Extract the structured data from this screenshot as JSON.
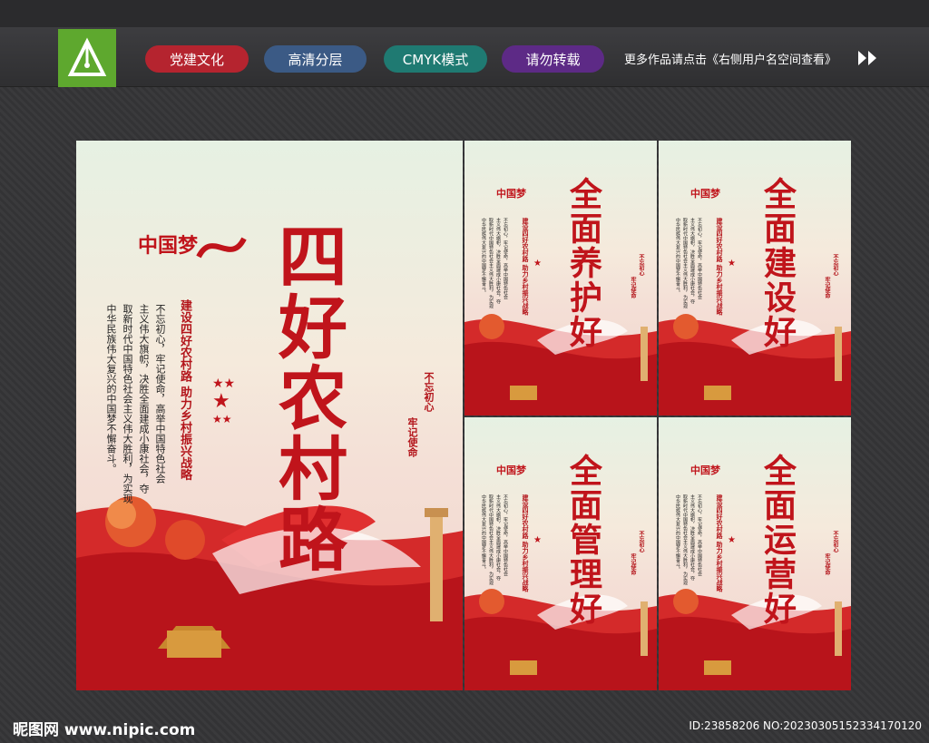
{
  "header": {
    "tags": [
      "党建文化",
      "高清分层",
      "CMYK模式",
      "请勿转载"
    ],
    "more_text": "更多作品请点击《右侧用户名空间查看》",
    "logo_icon": "pen-nib-icon"
  },
  "main_poster": {
    "logo_text": "中国梦",
    "title": "四好农村路",
    "subtitle": "建设四好农村路  助力乡村振兴战略",
    "body_lines": [
      "不忘初心，牢记使命，高举中国特色社会",
      "主义伟大旗帜，决胜全面建成小康社会，夺",
      "取新时代中国特色社会主义伟大胜利，为实现",
      "中华民族伟大复兴的中国梦不懈奋斗。"
    ],
    "slogan1": "不忘初心",
    "slogan2": "牢记使命"
  },
  "small_posters": [
    {
      "title": "全面养护好"
    },
    {
      "title": "全面建设好"
    },
    {
      "title": "全面管理好"
    },
    {
      "title": "全面运营好"
    }
  ],
  "small_common": {
    "logo_text": "中国梦",
    "subtitle": "建设四好农村路  助力乡村振兴战略",
    "body_lines": [
      "不忘初心，牢记使命，高举中国特色社会",
      "主义伟大旗帜，决胜全面建成小康社会，夺",
      "取新时代中国特色社会主义伟大胜利，为实现",
      "中华民族伟大复兴的中国梦不懈奋斗。"
    ],
    "slogan1": "不忘初心",
    "slogan2": "牢记使命"
  },
  "footer": {
    "left": "昵图网 www.nipic.com",
    "right": "ID:23858206 NO:20230305152334170120"
  }
}
